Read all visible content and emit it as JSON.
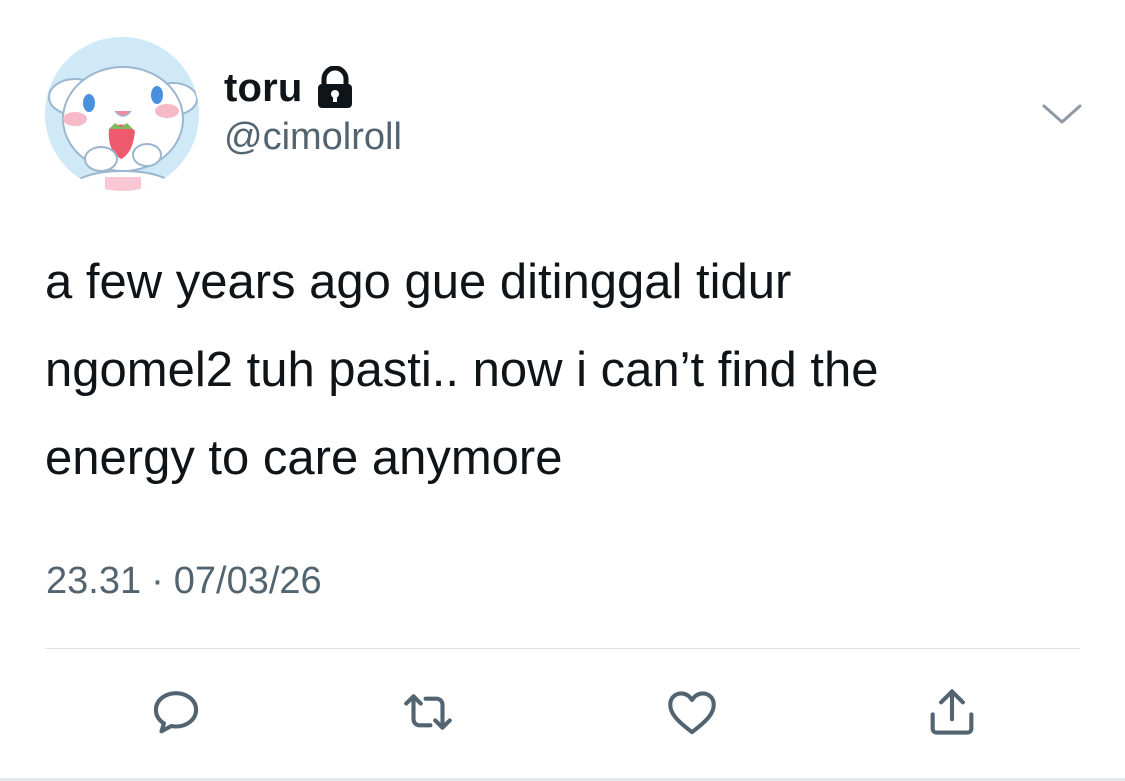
{
  "tweet": {
    "author": {
      "display_name": "toru",
      "handle": "@cimolroll",
      "protected_icon": "lock-icon",
      "avatar": "avatar-image"
    },
    "menu_icon": "chevron-down-icon",
    "text_lines": [
      "a few years ago gue ditinggal tidur",
      "ngomel2 tuh pasti.. now i can’t find the",
      "energy to care anymore"
    ],
    "time": "23.31",
    "separator": "·",
    "date": "07/03/26",
    "actions": {
      "reply_icon": "reply-icon",
      "retweet_icon": "retweet-icon",
      "like_icon": "heart-icon",
      "share_icon": "share-icon"
    }
  },
  "colors": {
    "text_primary": "#0f1419",
    "text_secondary": "#536471",
    "divider": "#dfe3e6",
    "icon": "#536471"
  }
}
